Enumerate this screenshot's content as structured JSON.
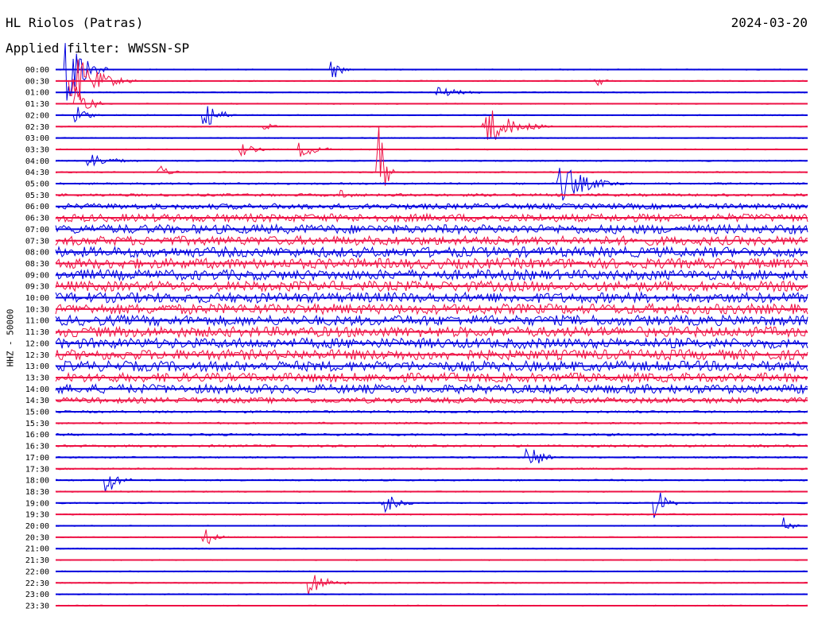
{
  "station": "HL Riolos (Patras)",
  "date": "2024-03-20",
  "filter_label": "Applied filter: WWSSN-SP",
  "channel_label": "HHZ - 50000",
  "chart_data": {
    "type": "line",
    "title": "HL Riolos (Patras)",
    "ylabel": "HHZ - 50000",
    "xlabel": "",
    "row_labels": [
      "00:00",
      "00:30",
      "01:00",
      "01:30",
      "02:00",
      "02:30",
      "03:00",
      "03:30",
      "04:00",
      "04:30",
      "05:00",
      "05:30",
      "06:00",
      "06:30",
      "07:00",
      "07:30",
      "08:00",
      "08:30",
      "09:00",
      "09:30",
      "10:00",
      "10:30",
      "11:00",
      "11:30",
      "12:00",
      "12:30",
      "13:00",
      "13:30",
      "14:00",
      "14:30",
      "15:00",
      "15:30",
      "16:00",
      "16:30",
      "17:00",
      "17:30",
      "18:00",
      "18:30",
      "19:00",
      "19:30",
      "20:00",
      "20:30",
      "21:00",
      "21:30",
      "22:00",
      "22:30",
      "23:00",
      "23:30"
    ],
    "x_range_minutes": [
      0,
      30
    ],
    "row_colors": [
      "#0000dd",
      "#ee1144"
    ],
    "relative_noise_level": [
      0.05,
      0.05,
      0.05,
      0.05,
      0.05,
      0.05,
      0.05,
      0.05,
      0.06,
      0.06,
      0.08,
      0.12,
      0.25,
      0.35,
      0.4,
      0.4,
      0.45,
      0.45,
      0.45,
      0.45,
      0.45,
      0.45,
      0.45,
      0.45,
      0.45,
      0.45,
      0.45,
      0.4,
      0.4,
      0.25,
      0.1,
      0.08,
      0.1,
      0.1,
      0.07,
      0.07,
      0.07,
      0.06,
      0.06,
      0.06,
      0.05,
      0.05,
      0.05,
      0.05,
      0.05,
      0.05,
      0.05,
      0.05
    ],
    "events": [
      {
        "row": 0,
        "x": 0.02,
        "amp": 3.5,
        "dur": 0.05
      },
      {
        "row": 0,
        "x": 0.37,
        "amp": 0.8,
        "dur": 0.03
      },
      {
        "row": 1,
        "x": 0.03,
        "amp": 2.0,
        "dur": 0.08
      },
      {
        "row": 1,
        "x": 0.72,
        "amp": 0.6,
        "dur": 0.02
      },
      {
        "row": 2,
        "x": 0.51,
        "amp": 0.5,
        "dur": 0.06
      },
      {
        "row": 3,
        "x": 0.03,
        "amp": 1.5,
        "dur": 0.04
      },
      {
        "row": 4,
        "x": 0.2,
        "amp": 1.6,
        "dur": 0.04
      },
      {
        "row": 4,
        "x": 0.03,
        "amp": 0.8,
        "dur": 0.03
      },
      {
        "row": 5,
        "x": 0.28,
        "amp": 0.3,
        "dur": 0.03
      },
      {
        "row": 5,
        "x": 0.58,
        "amp": 1.5,
        "dur": 0.08
      },
      {
        "row": 7,
        "x": 0.25,
        "amp": 0.5,
        "dur": 0.04
      },
      {
        "row": 7,
        "x": 0.33,
        "amp": 0.6,
        "dur": 0.05
      },
      {
        "row": 8,
        "x": 0.05,
        "amp": 0.6,
        "dur": 0.06
      },
      {
        "row": 9,
        "x": 0.14,
        "amp": 0.5,
        "dur": 0.03
      },
      {
        "row": 10,
        "x": 0.68,
        "amp": 1.4,
        "dur": 0.08
      },
      {
        "row": 9,
        "x": 0.43,
        "amp": 5.0,
        "dur": 0.02
      },
      {
        "row": 11,
        "x": 0.38,
        "amp": 0.5,
        "dur": 0.02
      },
      {
        "row": 36,
        "x": 0.07,
        "amp": 1.4,
        "dur": 0.03
      },
      {
        "row": 38,
        "x": 0.44,
        "amp": 0.8,
        "dur": 0.04
      },
      {
        "row": 38,
        "x": 0.8,
        "amp": 1.4,
        "dur": 0.03
      },
      {
        "row": 40,
        "x": 0.97,
        "amp": 0.8,
        "dur": 0.02
      },
      {
        "row": 41,
        "x": 0.2,
        "amp": 0.8,
        "dur": 0.03
      },
      {
        "row": 45,
        "x": 0.34,
        "amp": 1.2,
        "dur": 0.05
      },
      {
        "row": 34,
        "x": 0.63,
        "amp": 1.3,
        "dur": 0.04
      }
    ],
    "grid": false,
    "legend": "none"
  }
}
